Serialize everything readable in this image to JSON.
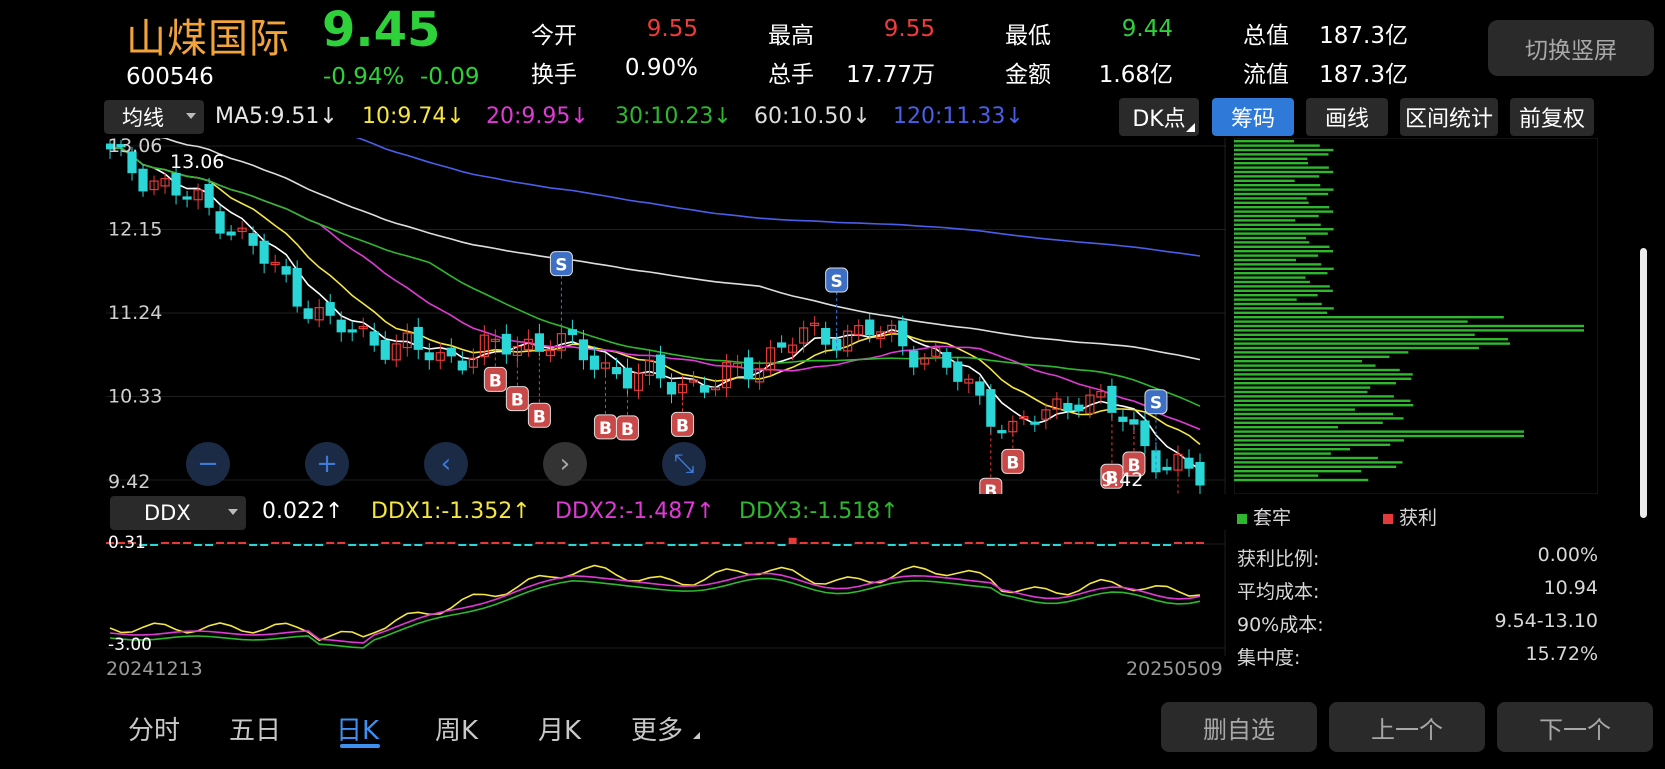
{
  "header": {
    "name": "山煤国际",
    "price": "9.45",
    "code": "600546",
    "change_pct": "-0.94%",
    "change_abs": "-0.09",
    "quotes": [
      {
        "label": "今开",
        "value": "9.55",
        "color": "#f23a3a"
      },
      {
        "label": "最高",
        "value": "9.55",
        "color": "#f23a3a"
      },
      {
        "label": "最低",
        "value": "9.44",
        "color": "#2ed13a"
      },
      {
        "label": "总值",
        "value": "187.3亿",
        "color": "#ffffff"
      },
      {
        "label": "换手",
        "value": "0.90%",
        "color": "#ffffff"
      },
      {
        "label": "总手",
        "value": "17.77万",
        "color": "#ffffff"
      },
      {
        "label": "金额",
        "value": "1.68亿",
        "color": "#ffffff"
      },
      {
        "label": "流值",
        "value": "187.3亿",
        "color": "#ffffff"
      }
    ],
    "switch_label": "切换竖屏"
  },
  "ma_bar": {
    "select_label": "均线",
    "items": [
      {
        "text": "MA5:9.51↓",
        "color": "#ffffff"
      },
      {
        "text": "10:9.74↓",
        "color": "#f5e642"
      },
      {
        "text": "20:9.95↓",
        "color": "#e03ad6"
      },
      {
        "text": "30:10.23↓",
        "color": "#2fb82f"
      },
      {
        "text": "60:10.50↓",
        "color": "#dddddd"
      },
      {
        "text": "120:11.33↓",
        "color": "#4a5ee8"
      }
    ],
    "buttons": [
      "DK点",
      "筹码",
      "画线",
      "区间统计",
      "前复权"
    ]
  },
  "chart_data": [
    {
      "type": "candlestick",
      "title": "",
      "y_tick_labels": [
        "13.06",
        "12.15",
        "11.24",
        "10.33",
        "9.42"
      ],
      "ylim": [
        9.42,
        13.06
      ],
      "high_label": "13.06",
      "low_label": "9.42",
      "ma_lines": [
        "MA5",
        "MA10",
        "MA20",
        "MA30",
        "MA60",
        "MA120"
      ],
      "signals": [
        {
          "label": "S",
          "index": 21
        },
        {
          "label": "S",
          "index": 34
        },
        {
          "label": "B",
          "index": 18
        },
        {
          "label": "B",
          "index": 19
        },
        {
          "label": "B",
          "index": 20
        },
        {
          "label": "B",
          "index": 23
        },
        {
          "label": "B",
          "index": 24
        },
        {
          "label": "B",
          "index": 27
        },
        {
          "label": "B",
          "index": 41
        },
        {
          "label": "B",
          "index": 42
        },
        {
          "label": "B",
          "index": 47
        },
        {
          "label": "B",
          "index": 48
        },
        {
          "label": "S",
          "index": 49
        },
        {
          "label": "B",
          "index": 50
        }
      ],
      "x_start": "20241213",
      "x_end": "20250509"
    },
    {
      "type": "line",
      "title": "DDX",
      "y_tick_labels": [
        "0.31",
        "-3.00"
      ],
      "series": [
        {
          "name": "DDX",
          "value": "0.022↑",
          "color": "#ffffff"
        },
        {
          "name": "DDX1",
          "value": "-1.352↑",
          "color": "#f5e642"
        },
        {
          "name": "DDX2",
          "value": "-1.487↑",
          "color": "#e03ad6"
        },
        {
          "name": "DDX3",
          "value": "-1.518↑",
          "color": "#2fb82f"
        }
      ]
    }
  ],
  "ddx_bar": {
    "select_label": "DDX",
    "items": [
      {
        "text": "0.022↑",
        "color": "#ffffff"
      },
      {
        "text": "DDX1:-1.352↑",
        "color": "#f5e642"
      },
      {
        "text": "DDX2:-1.487↑",
        "color": "#e03ad6"
      },
      {
        "text": "DDX3:-1.518↑",
        "color": "#2fb82f"
      }
    ]
  },
  "chips": {
    "legend": [
      {
        "label": "套牢",
        "color": "#2fb82f"
      },
      {
        "label": "获利",
        "color": "#e63a3a"
      }
    ],
    "stats": [
      {
        "label": "获利比例:",
        "value": "0.00%"
      },
      {
        "label": "平均成本:",
        "value": "10.94"
      },
      {
        "label": "90%成本:",
        "value": "9.54-13.10"
      },
      {
        "label": "集中度:",
        "value": "15.72%"
      }
    ]
  },
  "nav_icons": [
    "zoom-out-icon",
    "zoom-in-icon",
    "left-icon",
    "right-icon",
    "collapse-icon"
  ],
  "tabs": [
    "分时",
    "五日",
    "日K",
    "周K",
    "月K",
    "更多"
  ],
  "active_tab": "日K",
  "bottom_buttons": [
    "删自选",
    "上一个",
    "下一个"
  ]
}
